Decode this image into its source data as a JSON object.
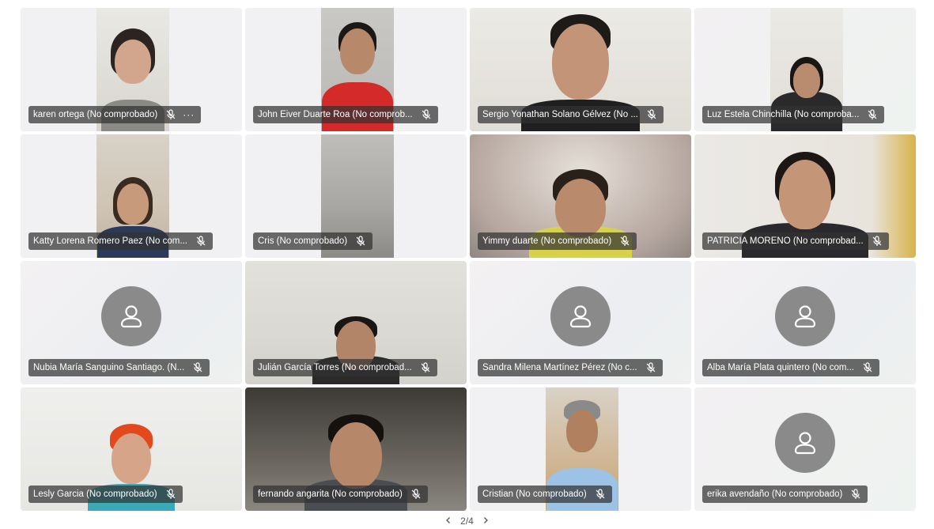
{
  "participants": [
    {
      "name": "karen ortega (No comprobado)",
      "has_more": true,
      "more_label": "···",
      "muted": true,
      "video": "narrow"
    },
    {
      "name": "John Eiver Duarte Roa (No comprob...",
      "muted": true,
      "video": "narrow"
    },
    {
      "name": "Sergio Yonathan Solano Gélvez (No ...",
      "muted": true,
      "video": "full"
    },
    {
      "name": "Luz Estela Chinchilla (No comproba...",
      "muted": true,
      "video": "narrow"
    },
    {
      "name": "Katty Lorena Romero Paez (No com...",
      "muted": true,
      "video": "narrow"
    },
    {
      "name": "Cris (No comprobado)",
      "muted": true,
      "video": "narrow"
    },
    {
      "name": "Yimmy duarte (No comprobado)",
      "muted": true,
      "video": "full"
    },
    {
      "name": "PATRICIA MORENO (No comprobad...",
      "muted": true,
      "video": "full"
    },
    {
      "name": "Nubia María Sanguino Santiago. (N...",
      "muted": true,
      "video": "none"
    },
    {
      "name": "Julián García Torres (No comprobad...",
      "muted": true,
      "video": "full"
    },
    {
      "name": "Sandra Milena Martínez Pérez (No c...",
      "muted": true,
      "video": "none"
    },
    {
      "name": "Alba María Plata quintero (No com...",
      "muted": true,
      "video": "none"
    },
    {
      "name": "Lesly Garcia (No comprobado)",
      "muted": true,
      "video": "full"
    },
    {
      "name": "fernando angarita (No comprobado)",
      "muted": true,
      "video": "full"
    },
    {
      "name": "Cristian (No comprobado)",
      "muted": true,
      "video": "narrow"
    },
    {
      "name": "erika avendaño (No comprobado)",
      "muted": true,
      "video": "none"
    }
  ],
  "pager": {
    "prev_icon": "chevron-left-icon",
    "label": "2/4",
    "next_icon": "chevron-right-icon"
  },
  "colors": {
    "label_bg": "#323232",
    "avatar_bg": "#8a8a8a"
  }
}
